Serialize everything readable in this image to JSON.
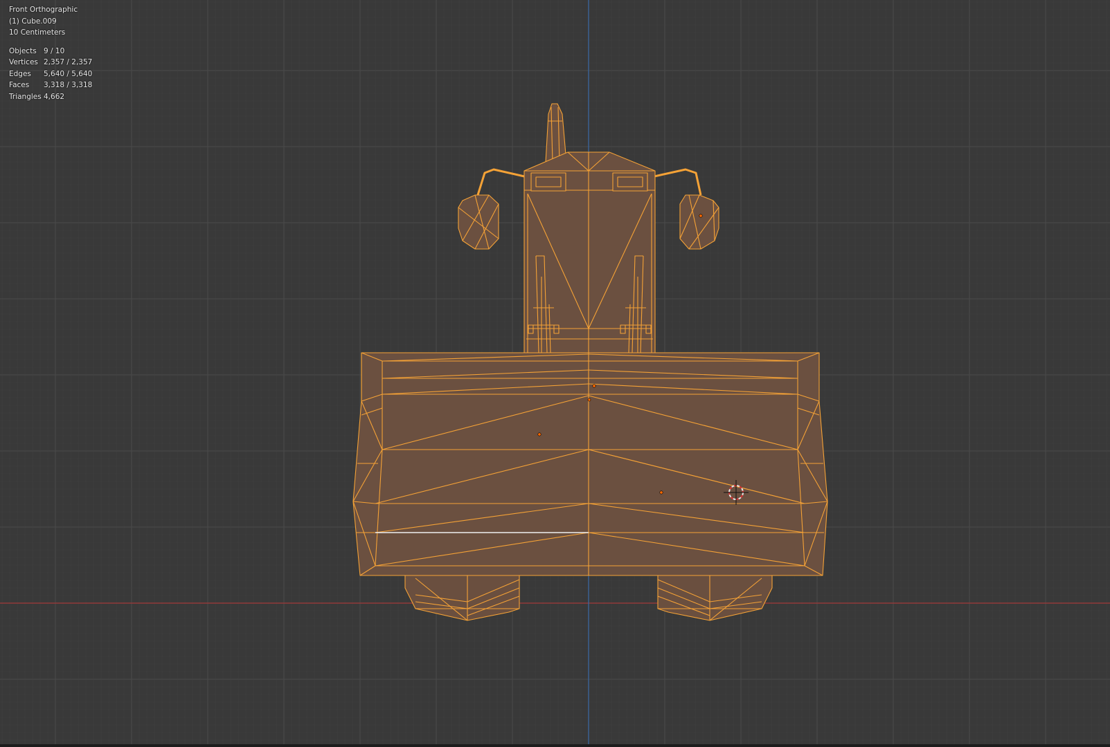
{
  "viewport": {
    "view_name": "Front Orthographic",
    "active_object": "(1) Cube.009",
    "grid_scale": "10 Centimeters",
    "stats": [
      {
        "label": "Objects",
        "value": "9 / 10"
      },
      {
        "label": "Vertices",
        "value": "2,357 / 2,357"
      },
      {
        "label": "Edges",
        "value": "5,640 / 5,640"
      },
      {
        "label": "Faces",
        "value": "3,318 / 3,318"
      },
      {
        "label": "Triangles",
        "value": "4,662"
      }
    ]
  },
  "colors": {
    "background": "#393939",
    "grid_minor": "#404040",
    "grid_major": "#4a4a4a",
    "x_axis": "#a33a3a",
    "z_axis": "#3a6aa8",
    "selection_wire": "#f5a236",
    "selection_fill": "#6b5040",
    "origin_dot": "#ff6a00",
    "cursor": "#e8e8e8"
  }
}
